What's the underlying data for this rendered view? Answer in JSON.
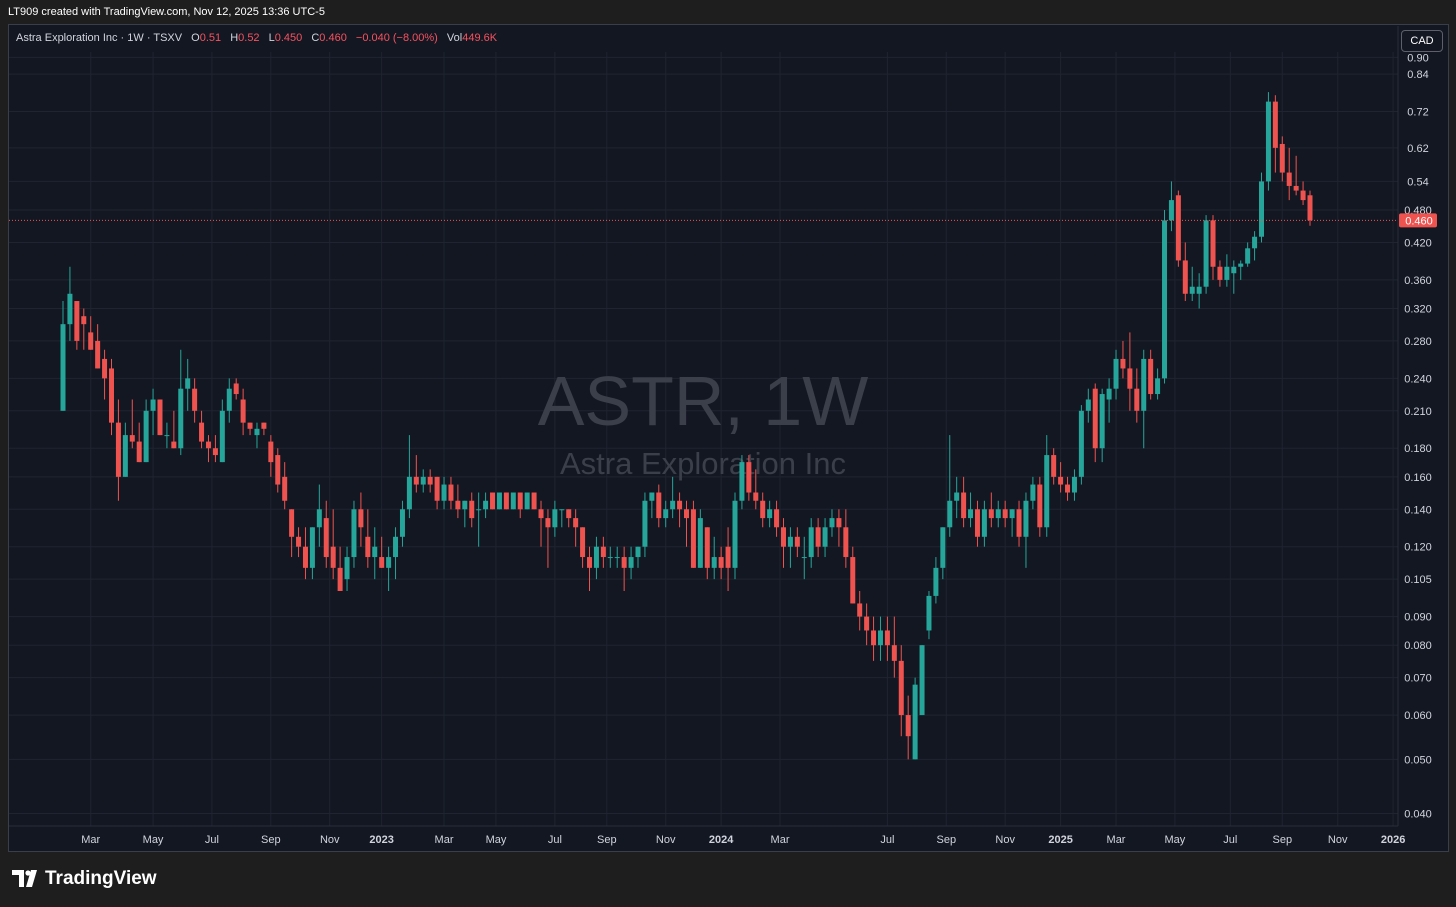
{
  "header": {
    "credit": "LT909 created with TradingView.com, Nov 12, 2025 13:36 UTC-5"
  },
  "legend": {
    "symbol": "Astra Exploration Inc · 1W · TSXV",
    "o_label": "O",
    "o_value": "0.51",
    "h_label": "H",
    "h_value": "0.52",
    "l_label": "L",
    "l_value": "0.450",
    "c_label": "C",
    "c_value": "0.460",
    "change": "−0.040 (−8.00%)",
    "vol_label": "Vol",
    "vol_value": "449.6K"
  },
  "currency_button": "CAD",
  "footer": {
    "brand": "TradingView"
  },
  "colors": {
    "up": "#26a69a",
    "down": "#ef5350",
    "background": "#131722",
    "grid": "#1f2430",
    "axis_text": "#d1d4dc",
    "watermark": "#3b3f4a"
  },
  "chart_data": {
    "type": "candlestick",
    "title": "ASTR, 1W",
    "subtitle": "Astra Exploration Inc",
    "scale": "log",
    "ylim": [
      0.038,
      0.92
    ],
    "y_ticks": [
      "0.90",
      "0.84",
      "0.72",
      "0.62",
      "0.54",
      "0.480",
      "0.420",
      "0.360",
      "0.320",
      "0.280",
      "0.240",
      "0.210",
      "0.180",
      "0.160",
      "0.140",
      "0.120",
      "0.105",
      "0.090",
      "0.080",
      "0.070",
      "0.060",
      "0.050",
      "0.040"
    ],
    "last_price": "0.460",
    "x_labels": [
      "Mar",
      "May",
      "Jul",
      "Sep",
      "Nov",
      "2023",
      "Mar",
      "May",
      "Jul",
      "Sep",
      "Nov",
      "2024",
      "Mar",
      "Jul",
      "Sep",
      "Nov",
      "2025",
      "Mar",
      "May",
      "Jul",
      "Sep",
      "Nov",
      "2026"
    ],
    "candles": [
      {
        "o": 0.21,
        "h": 0.33,
        "l": 0.21,
        "c": 0.3
      },
      {
        "o": 0.3,
        "h": 0.38,
        "l": 0.28,
        "c": 0.34
      },
      {
        "o": 0.33,
        "h": 0.33,
        "l": 0.27,
        "c": 0.28
      },
      {
        "o": 0.31,
        "h": 0.32,
        "l": 0.27,
        "c": 0.3
      },
      {
        "o": 0.29,
        "h": 0.31,
        "l": 0.27,
        "c": 0.27
      },
      {
        "o": 0.28,
        "h": 0.3,
        "l": 0.25,
        "c": 0.25
      },
      {
        "o": 0.26,
        "h": 0.27,
        "l": 0.22,
        "c": 0.24
      },
      {
        "o": 0.25,
        "h": 0.26,
        "l": 0.19,
        "c": 0.2
      },
      {
        "o": 0.2,
        "h": 0.22,
        "l": 0.145,
        "c": 0.16
      },
      {
        "o": 0.16,
        "h": 0.2,
        "l": 0.16,
        "c": 0.19
      },
      {
        "o": 0.19,
        "h": 0.22,
        "l": 0.18,
        "c": 0.185
      },
      {
        "o": 0.185,
        "h": 0.2,
        "l": 0.17,
        "c": 0.17
      },
      {
        "o": 0.17,
        "h": 0.22,
        "l": 0.17,
        "c": 0.21
      },
      {
        "o": 0.21,
        "h": 0.23,
        "l": 0.19,
        "c": 0.22
      },
      {
        "o": 0.22,
        "h": 0.22,
        "l": 0.19,
        "c": 0.19
      },
      {
        "o": 0.19,
        "h": 0.2,
        "l": 0.18,
        "c": 0.19
      },
      {
        "o": 0.185,
        "h": 0.21,
        "l": 0.18,
        "c": 0.18
      },
      {
        "o": 0.18,
        "h": 0.27,
        "l": 0.175,
        "c": 0.23
      },
      {
        "o": 0.23,
        "h": 0.26,
        "l": 0.21,
        "c": 0.24
      },
      {
        "o": 0.23,
        "h": 0.24,
        "l": 0.2,
        "c": 0.21
      },
      {
        "o": 0.2,
        "h": 0.21,
        "l": 0.18,
        "c": 0.185
      },
      {
        "o": 0.185,
        "h": 0.19,
        "l": 0.17,
        "c": 0.18
      },
      {
        "o": 0.18,
        "h": 0.19,
        "l": 0.17,
        "c": 0.175
      },
      {
        "o": 0.17,
        "h": 0.22,
        "l": 0.17,
        "c": 0.21
      },
      {
        "o": 0.21,
        "h": 0.24,
        "l": 0.2,
        "c": 0.23
      },
      {
        "o": 0.235,
        "h": 0.24,
        "l": 0.22,
        "c": 0.225
      },
      {
        "o": 0.22,
        "h": 0.23,
        "l": 0.19,
        "c": 0.2
      },
      {
        "o": 0.2,
        "h": 0.2,
        "l": 0.19,
        "c": 0.195
      },
      {
        "o": 0.19,
        "h": 0.2,
        "l": 0.18,
        "c": 0.195
      },
      {
        "o": 0.2,
        "h": 0.2,
        "l": 0.19,
        "c": 0.195
      },
      {
        "o": 0.185,
        "h": 0.19,
        "l": 0.16,
        "c": 0.17
      },
      {
        "o": 0.175,
        "h": 0.18,
        "l": 0.15,
        "c": 0.155
      },
      {
        "o": 0.16,
        "h": 0.17,
        "l": 0.14,
        "c": 0.145
      },
      {
        "o": 0.14,
        "h": 0.14,
        "l": 0.115,
        "c": 0.125
      },
      {
        "o": 0.125,
        "h": 0.13,
        "l": 0.115,
        "c": 0.12
      },
      {
        "o": 0.12,
        "h": 0.13,
        "l": 0.105,
        "c": 0.11
      },
      {
        "o": 0.11,
        "h": 0.13,
        "l": 0.105,
        "c": 0.13
      },
      {
        "o": 0.13,
        "h": 0.155,
        "l": 0.12,
        "c": 0.14
      },
      {
        "o": 0.135,
        "h": 0.145,
        "l": 0.11,
        "c": 0.115
      },
      {
        "o": 0.12,
        "h": 0.14,
        "l": 0.105,
        "c": 0.11
      },
      {
        "o": 0.11,
        "h": 0.12,
        "l": 0.1,
        "c": 0.1
      },
      {
        "o": 0.105,
        "h": 0.12,
        "l": 0.1,
        "c": 0.115
      },
      {
        "o": 0.115,
        "h": 0.145,
        "l": 0.11,
        "c": 0.14
      },
      {
        "o": 0.14,
        "h": 0.15,
        "l": 0.12,
        "c": 0.13
      },
      {
        "o": 0.125,
        "h": 0.14,
        "l": 0.11,
        "c": 0.115
      },
      {
        "o": 0.115,
        "h": 0.13,
        "l": 0.105,
        "c": 0.12
      },
      {
        "o": 0.115,
        "h": 0.125,
        "l": 0.11,
        "c": 0.11
      },
      {
        "o": 0.11,
        "h": 0.12,
        "l": 0.1,
        "c": 0.115
      },
      {
        "o": 0.115,
        "h": 0.13,
        "l": 0.105,
        "c": 0.125
      },
      {
        "o": 0.125,
        "h": 0.145,
        "l": 0.12,
        "c": 0.14
      },
      {
        "o": 0.14,
        "h": 0.19,
        "l": 0.135,
        "c": 0.16
      },
      {
        "o": 0.16,
        "h": 0.175,
        "l": 0.15,
        "c": 0.155
      },
      {
        "o": 0.155,
        "h": 0.165,
        "l": 0.15,
        "c": 0.16
      },
      {
        "o": 0.16,
        "h": 0.165,
        "l": 0.15,
        "c": 0.155
      },
      {
        "o": 0.16,
        "h": 0.16,
        "l": 0.14,
        "c": 0.145
      },
      {
        "o": 0.145,
        "h": 0.16,
        "l": 0.14,
        "c": 0.155
      },
      {
        "o": 0.155,
        "h": 0.16,
        "l": 0.14,
        "c": 0.145
      },
      {
        "o": 0.145,
        "h": 0.155,
        "l": 0.135,
        "c": 0.14
      },
      {
        "o": 0.14,
        "h": 0.145,
        "l": 0.13,
        "c": 0.145
      },
      {
        "o": 0.145,
        "h": 0.15,
        "l": 0.13,
        "c": 0.135
      },
      {
        "o": 0.14,
        "h": 0.15,
        "l": 0.12,
        "c": 0.14
      },
      {
        "o": 0.14,
        "h": 0.15,
        "l": 0.135,
        "c": 0.145
      },
      {
        "o": 0.15,
        "h": 0.15,
        "l": 0.14,
        "c": 0.14
      },
      {
        "o": 0.14,
        "h": 0.15,
        "l": 0.14,
        "c": 0.15
      },
      {
        "o": 0.15,
        "h": 0.15,
        "l": 0.14,
        "c": 0.14
      },
      {
        "o": 0.14,
        "h": 0.15,
        "l": 0.14,
        "c": 0.15
      },
      {
        "o": 0.15,
        "h": 0.15,
        "l": 0.135,
        "c": 0.14
      },
      {
        "o": 0.14,
        "h": 0.15,
        "l": 0.14,
        "c": 0.15
      },
      {
        "o": 0.15,
        "h": 0.15,
        "l": 0.14,
        "c": 0.14
      },
      {
        "o": 0.14,
        "h": 0.145,
        "l": 0.12,
        "c": 0.135
      },
      {
        "o": 0.135,
        "h": 0.14,
        "l": 0.11,
        "c": 0.13
      },
      {
        "o": 0.13,
        "h": 0.145,
        "l": 0.125,
        "c": 0.14
      },
      {
        "o": 0.14,
        "h": 0.14,
        "l": 0.13,
        "c": 0.14
      },
      {
        "o": 0.14,
        "h": 0.14,
        "l": 0.13,
        "c": 0.135
      },
      {
        "o": 0.135,
        "h": 0.14,
        "l": 0.12,
        "c": 0.13
      },
      {
        "o": 0.13,
        "h": 0.13,
        "l": 0.11,
        "c": 0.115
      },
      {
        "o": 0.115,
        "h": 0.12,
        "l": 0.1,
        "c": 0.11
      },
      {
        "o": 0.11,
        "h": 0.125,
        "l": 0.105,
        "c": 0.12
      },
      {
        "o": 0.12,
        "h": 0.125,
        "l": 0.11,
        "c": 0.115
      },
      {
        "o": 0.115,
        "h": 0.12,
        "l": 0.11,
        "c": 0.115
      },
      {
        "o": 0.115,
        "h": 0.12,
        "l": 0.11,
        "c": 0.115
      },
      {
        "o": 0.115,
        "h": 0.12,
        "l": 0.1,
        "c": 0.11
      },
      {
        "o": 0.11,
        "h": 0.12,
        "l": 0.105,
        "c": 0.115
      },
      {
        "o": 0.115,
        "h": 0.12,
        "l": 0.11,
        "c": 0.12
      },
      {
        "o": 0.12,
        "h": 0.15,
        "l": 0.115,
        "c": 0.145
      },
      {
        "o": 0.145,
        "h": 0.15,
        "l": 0.135,
        "c": 0.15
      },
      {
        "o": 0.15,
        "h": 0.155,
        "l": 0.13,
        "c": 0.135
      },
      {
        "o": 0.135,
        "h": 0.145,
        "l": 0.13,
        "c": 0.14
      },
      {
        "o": 0.14,
        "h": 0.16,
        "l": 0.135,
        "c": 0.145
      },
      {
        "o": 0.145,
        "h": 0.15,
        "l": 0.13,
        "c": 0.14
      },
      {
        "o": 0.14,
        "h": 0.145,
        "l": 0.12,
        "c": 0.135
      },
      {
        "o": 0.14,
        "h": 0.145,
        "l": 0.11,
        "c": 0.11
      },
      {
        "o": 0.11,
        "h": 0.14,
        "l": 0.11,
        "c": 0.135
      },
      {
        "o": 0.13,
        "h": 0.13,
        "l": 0.105,
        "c": 0.11
      },
      {
        "o": 0.11,
        "h": 0.125,
        "l": 0.105,
        "c": 0.115
      },
      {
        "o": 0.115,
        "h": 0.12,
        "l": 0.105,
        "c": 0.11
      },
      {
        "o": 0.12,
        "h": 0.13,
        "l": 0.1,
        "c": 0.11
      },
      {
        "o": 0.11,
        "h": 0.15,
        "l": 0.105,
        "c": 0.145
      },
      {
        "o": 0.145,
        "h": 0.175,
        "l": 0.14,
        "c": 0.17
      },
      {
        "o": 0.17,
        "h": 0.175,
        "l": 0.145,
        "c": 0.15
      },
      {
        "o": 0.15,
        "h": 0.165,
        "l": 0.14,
        "c": 0.145
      },
      {
        "o": 0.145,
        "h": 0.15,
        "l": 0.13,
        "c": 0.135
      },
      {
        "o": 0.135,
        "h": 0.145,
        "l": 0.13,
        "c": 0.14
      },
      {
        "o": 0.14,
        "h": 0.145,
        "l": 0.125,
        "c": 0.13
      },
      {
        "o": 0.13,
        "h": 0.135,
        "l": 0.11,
        "c": 0.12
      },
      {
        "o": 0.12,
        "h": 0.13,
        "l": 0.11,
        "c": 0.125
      },
      {
        "o": 0.125,
        "h": 0.13,
        "l": 0.115,
        "c": 0.12
      },
      {
        "o": 0.115,
        "h": 0.125,
        "l": 0.105,
        "c": 0.115
      },
      {
        "o": 0.115,
        "h": 0.135,
        "l": 0.11,
        "c": 0.13
      },
      {
        "o": 0.13,
        "h": 0.135,
        "l": 0.115,
        "c": 0.12
      },
      {
        "o": 0.12,
        "h": 0.135,
        "l": 0.115,
        "c": 0.13
      },
      {
        "o": 0.13,
        "h": 0.14,
        "l": 0.125,
        "c": 0.135
      },
      {
        "o": 0.135,
        "h": 0.14,
        "l": 0.12,
        "c": 0.13
      },
      {
        "o": 0.13,
        "h": 0.14,
        "l": 0.11,
        "c": 0.115
      },
      {
        "o": 0.115,
        "h": 0.12,
        "l": 0.095,
        "c": 0.095
      },
      {
        "o": 0.095,
        "h": 0.1,
        "l": 0.085,
        "c": 0.09
      },
      {
        "o": 0.09,
        "h": 0.095,
        "l": 0.08,
        "c": 0.085
      },
      {
        "o": 0.085,
        "h": 0.09,
        "l": 0.075,
        "c": 0.08
      },
      {
        "o": 0.08,
        "h": 0.09,
        "l": 0.075,
        "c": 0.085
      },
      {
        "o": 0.085,
        "h": 0.09,
        "l": 0.075,
        "c": 0.08
      },
      {
        "o": 0.08,
        "h": 0.09,
        "l": 0.07,
        "c": 0.075
      },
      {
        "o": 0.075,
        "h": 0.08,
        "l": 0.055,
        "c": 0.06
      },
      {
        "o": 0.06,
        "h": 0.065,
        "l": 0.05,
        "c": 0.055
      },
      {
        "o": 0.05,
        "h": 0.07,
        "l": 0.05,
        "c": 0.068
      },
      {
        "o": 0.06,
        "h": 0.08,
        "l": 0.06,
        "c": 0.08
      },
      {
        "o": 0.085,
        "h": 0.1,
        "l": 0.082,
        "c": 0.098
      },
      {
        "o": 0.098,
        "h": 0.115,
        "l": 0.095,
        "c": 0.11
      },
      {
        "o": 0.11,
        "h": 0.13,
        "l": 0.105,
        "c": 0.13
      },
      {
        "o": 0.13,
        "h": 0.19,
        "l": 0.125,
        "c": 0.145
      },
      {
        "o": 0.145,
        "h": 0.16,
        "l": 0.135,
        "c": 0.15
      },
      {
        "o": 0.15,
        "h": 0.16,
        "l": 0.13,
        "c": 0.135
      },
      {
        "o": 0.135,
        "h": 0.15,
        "l": 0.13,
        "c": 0.14
      },
      {
        "o": 0.14,
        "h": 0.145,
        "l": 0.12,
        "c": 0.125
      },
      {
        "o": 0.125,
        "h": 0.145,
        "l": 0.12,
        "c": 0.14
      },
      {
        "o": 0.14,
        "h": 0.15,
        "l": 0.13,
        "c": 0.135
      },
      {
        "o": 0.135,
        "h": 0.145,
        "l": 0.13,
        "c": 0.14
      },
      {
        "o": 0.14,
        "h": 0.145,
        "l": 0.13,
        "c": 0.135
      },
      {
        "o": 0.135,
        "h": 0.14,
        "l": 0.125,
        "c": 0.14
      },
      {
        "o": 0.14,
        "h": 0.145,
        "l": 0.12,
        "c": 0.125
      },
      {
        "o": 0.125,
        "h": 0.15,
        "l": 0.11,
        "c": 0.145
      },
      {
        "o": 0.145,
        "h": 0.16,
        "l": 0.14,
        "c": 0.155
      },
      {
        "o": 0.155,
        "h": 0.16,
        "l": 0.125,
        "c": 0.13
      },
      {
        "o": 0.13,
        "h": 0.19,
        "l": 0.125,
        "c": 0.175
      },
      {
        "o": 0.175,
        "h": 0.18,
        "l": 0.155,
        "c": 0.16
      },
      {
        "o": 0.16,
        "h": 0.17,
        "l": 0.15,
        "c": 0.155
      },
      {
        "o": 0.155,
        "h": 0.16,
        "l": 0.145,
        "c": 0.15
      },
      {
        "o": 0.15,
        "h": 0.165,
        "l": 0.145,
        "c": 0.16
      },
      {
        "o": 0.16,
        "h": 0.215,
        "l": 0.155,
        "c": 0.21
      },
      {
        "o": 0.21,
        "h": 0.23,
        "l": 0.2,
        "c": 0.22
      },
      {
        "o": 0.23,
        "h": 0.235,
        "l": 0.17,
        "c": 0.18
      },
      {
        "o": 0.18,
        "h": 0.23,
        "l": 0.17,
        "c": 0.225
      },
      {
        "o": 0.22,
        "h": 0.24,
        "l": 0.2,
        "c": 0.23
      },
      {
        "o": 0.23,
        "h": 0.27,
        "l": 0.22,
        "c": 0.26
      },
      {
        "o": 0.26,
        "h": 0.28,
        "l": 0.24,
        "c": 0.25
      },
      {
        "o": 0.25,
        "h": 0.29,
        "l": 0.21,
        "c": 0.23
      },
      {
        "o": 0.23,
        "h": 0.25,
        "l": 0.2,
        "c": 0.21
      },
      {
        "o": 0.21,
        "h": 0.27,
        "l": 0.18,
        "c": 0.26
      },
      {
        "o": 0.26,
        "h": 0.27,
        "l": 0.22,
        "c": 0.225
      },
      {
        "o": 0.225,
        "h": 0.25,
        "l": 0.22,
        "c": 0.24
      },
      {
        "o": 0.24,
        "h": 0.48,
        "l": 0.235,
        "c": 0.46
      },
      {
        "o": 0.46,
        "h": 0.54,
        "l": 0.44,
        "c": 0.5
      },
      {
        "o": 0.51,
        "h": 0.52,
        "l": 0.38,
        "c": 0.39
      },
      {
        "o": 0.39,
        "h": 0.42,
        "l": 0.33,
        "c": 0.34
      },
      {
        "o": 0.34,
        "h": 0.38,
        "l": 0.33,
        "c": 0.35
      },
      {
        "o": 0.34,
        "h": 0.37,
        "l": 0.32,
        "c": 0.35
      },
      {
        "o": 0.35,
        "h": 0.47,
        "l": 0.34,
        "c": 0.46
      },
      {
        "o": 0.46,
        "h": 0.47,
        "l": 0.36,
        "c": 0.38
      },
      {
        "o": 0.38,
        "h": 0.39,
        "l": 0.35,
        "c": 0.36
      },
      {
        "o": 0.36,
        "h": 0.4,
        "l": 0.35,
        "c": 0.38
      },
      {
        "o": 0.37,
        "h": 0.39,
        "l": 0.34,
        "c": 0.38
      },
      {
        "o": 0.38,
        "h": 0.39,
        "l": 0.36,
        "c": 0.385
      },
      {
        "o": 0.385,
        "h": 0.42,
        "l": 0.38,
        "c": 0.41
      },
      {
        "o": 0.41,
        "h": 0.44,
        "l": 0.39,
        "c": 0.43
      },
      {
        "o": 0.43,
        "h": 0.56,
        "l": 0.42,
        "c": 0.54
      },
      {
        "o": 0.54,
        "h": 0.78,
        "l": 0.52,
        "c": 0.75
      },
      {
        "o": 0.75,
        "h": 0.77,
        "l": 0.56,
        "c": 0.62
      },
      {
        "o": 0.63,
        "h": 0.65,
        "l": 0.54,
        "c": 0.56
      },
      {
        "o": 0.56,
        "h": 0.62,
        "l": 0.5,
        "c": 0.53
      },
      {
        "o": 0.53,
        "h": 0.6,
        "l": 0.51,
        "c": 0.52
      },
      {
        "o": 0.52,
        "h": 0.54,
        "l": 0.49,
        "c": 0.5
      },
      {
        "o": 0.51,
        "h": 0.52,
        "l": 0.45,
        "c": 0.46
      }
    ]
  }
}
